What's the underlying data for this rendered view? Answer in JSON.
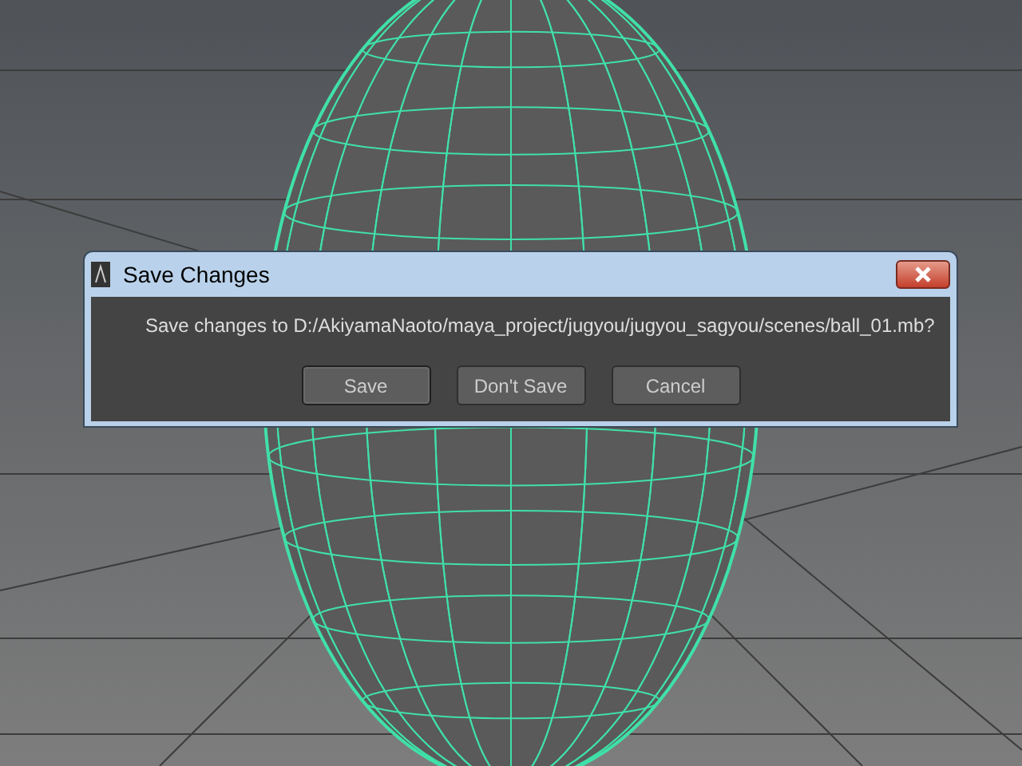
{
  "window": {
    "title": "Save Changes"
  },
  "message": "Save changes to D:/AkiyamaNaoto/maya_project/jugyou/jugyou_sagyou/scenes/ball_01.mb?",
  "buttons": [
    {
      "label": "Save",
      "selected": true
    },
    {
      "label": "Don't Save",
      "selected": false
    },
    {
      "label": "Cancel",
      "selected": false
    }
  ]
}
